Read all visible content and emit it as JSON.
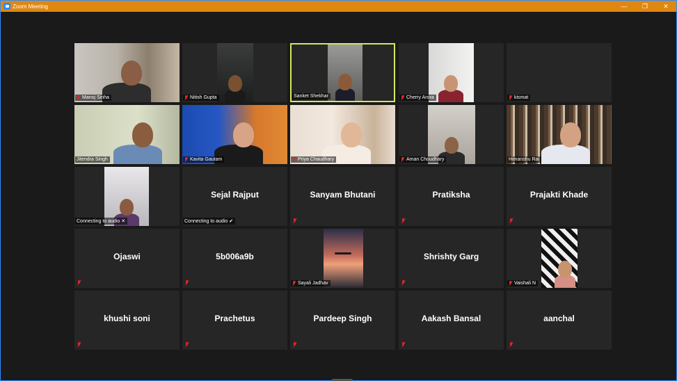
{
  "window": {
    "title": "Zoom Meeting",
    "accent": "#e0870f",
    "minimize_glyph": "—",
    "restore_glyph": "❐",
    "close_glyph": "✕"
  },
  "participants": [
    {
      "name": "Manoj Sinha",
      "video": true,
      "muted": true
    },
    {
      "name": "Nitish Gupta",
      "video": true,
      "muted": true
    },
    {
      "name": "Sanket Shekhar",
      "video": true,
      "muted": false,
      "active_speaker": true
    },
    {
      "name": "Cherry Arora",
      "video": true,
      "muted": true
    },
    {
      "name": "kismat",
      "video": false,
      "muted": true,
      "show_name_only_label": true
    },
    {
      "name": "Jitendra Singh",
      "video": true,
      "muted": false
    },
    {
      "name": "Kavita Gautam",
      "video": true,
      "muted": true
    },
    {
      "name": "Priya Chaudhary",
      "video": true,
      "muted": true
    },
    {
      "name": "Aman Choudhary",
      "video": true,
      "muted": true
    },
    {
      "name": "Himanshu Rai",
      "video": true,
      "muted": false
    },
    {
      "name": "",
      "video": true,
      "muted": false,
      "status": "Connecting to audio",
      "status_glyph": "✕"
    },
    {
      "name": "Sejal Rajput",
      "video": false,
      "muted": false,
      "status": "Connecting to audio",
      "status_glyph": "✔"
    },
    {
      "name": "Sanyam Bhutani",
      "video": false,
      "muted": true
    },
    {
      "name": "Pratiksha",
      "video": false,
      "muted": true
    },
    {
      "name": "Prajakti Khade",
      "video": false,
      "muted": true
    },
    {
      "name": "Ojaswi",
      "video": false,
      "muted": true
    },
    {
      "name": "5b006a9b",
      "video": false,
      "muted": true
    },
    {
      "name": "Sayali Jadhav",
      "video": true,
      "muted": true,
      "picture": true
    },
    {
      "name": "Shrishty Garg",
      "video": false,
      "muted": true
    },
    {
      "name": "Vaishali N",
      "video": true,
      "muted": true,
      "picture": true
    },
    {
      "name": "khushi soni",
      "video": false,
      "muted": true
    },
    {
      "name": "Prachetus",
      "video": false,
      "muted": true
    },
    {
      "name": "Pardeep Singh",
      "video": false,
      "muted": true
    },
    {
      "name": "Aakash Bansal",
      "video": false,
      "muted": true
    },
    {
      "name": "aanchal",
      "video": false,
      "muted": true
    }
  ]
}
